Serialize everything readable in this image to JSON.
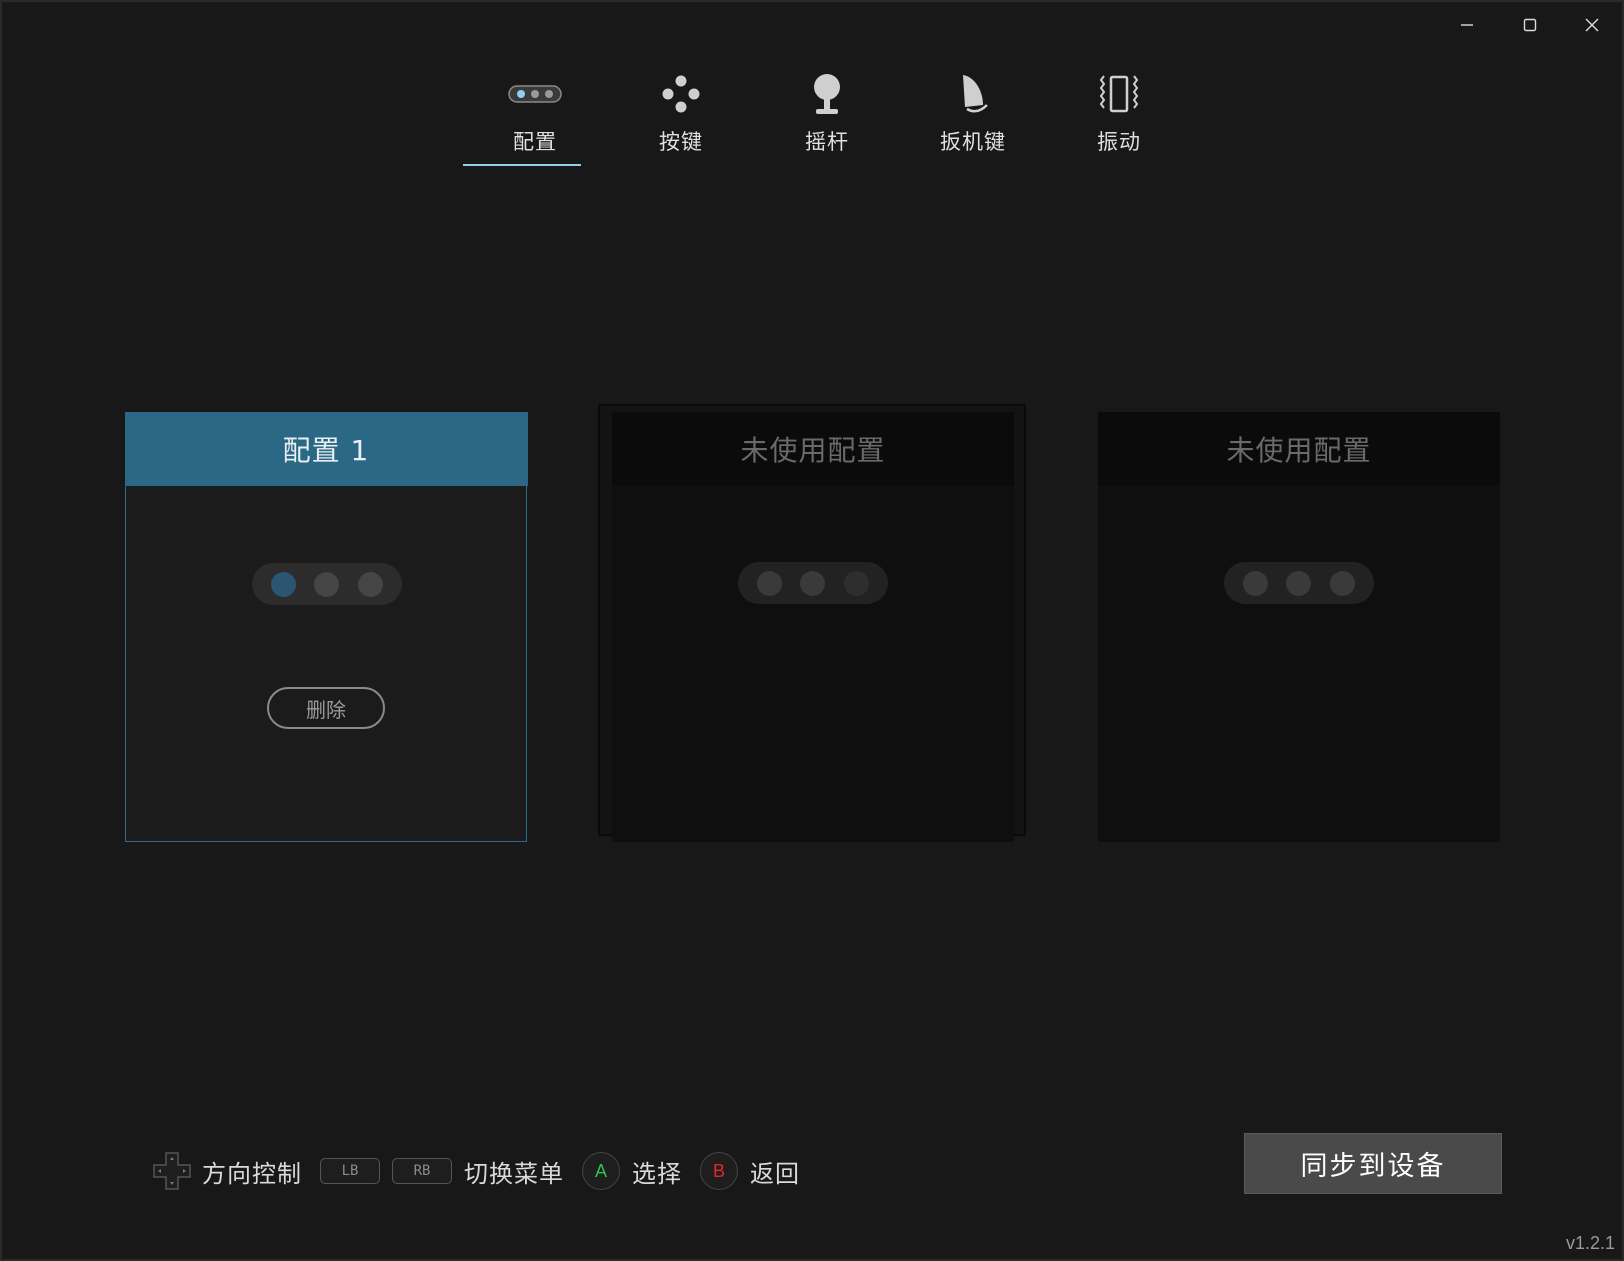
{
  "window": {
    "controls": {
      "minimize": "minimize",
      "maximize": "maximize",
      "close": "close"
    }
  },
  "nav": {
    "items": [
      {
        "label": "配置",
        "icon": "config-dots-icon",
        "active": true
      },
      {
        "label": "按键",
        "icon": "buttons-icon",
        "active": false
      },
      {
        "label": "摇杆",
        "icon": "joystick-icon",
        "active": false
      },
      {
        "label": "扳机键",
        "icon": "trigger-icon",
        "active": false
      },
      {
        "label": "振动",
        "icon": "vibration-icon",
        "active": false
      }
    ],
    "accent_color": "#8fd0ee"
  },
  "profiles": [
    {
      "title": "配置 1",
      "state": "active",
      "slot": 1,
      "delete_label": "删除"
    },
    {
      "title": "未使用配置",
      "state": "unused",
      "slot": 3
    },
    {
      "title": "未使用配置",
      "state": "unused",
      "slot": 2
    }
  ],
  "hints": {
    "dpad_label": "方向控制",
    "lb": "LB",
    "rb": "RB",
    "switch_label": "切换菜单",
    "a_key": "A",
    "select_label": "选择",
    "b_key": "B",
    "back_label": "返回"
  },
  "sync_button": "同步到设备",
  "version": "v1.2.1",
  "colors": {
    "active_header": "#2a6886",
    "active_border": "#2c6b89",
    "a_key": "#2ec44c",
    "b_key": "#e0282d",
    "background": "#181818"
  }
}
